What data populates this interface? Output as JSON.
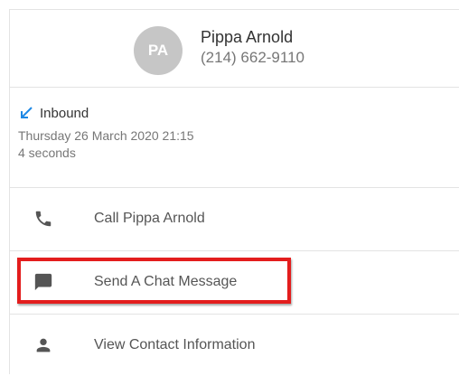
{
  "contact": {
    "initials": "PA",
    "name": "Pippa Arnold",
    "phone": "(214) 662-9110"
  },
  "call": {
    "direction": "Inbound",
    "date": "Thursday 26 March 2020 21:15",
    "duration": "4 seconds"
  },
  "actions": [
    {
      "label": "Call Pippa Arnold",
      "icon": "phone-icon"
    },
    {
      "label": "Send A Chat Message",
      "icon": "chat-icon"
    },
    {
      "label": "View Contact Information",
      "icon": "person-icon"
    }
  ],
  "colors": {
    "avatar_bg": "#c6c6c6",
    "inbound_arrow": "#1e88e5",
    "highlight": "#e31d1d",
    "divider": "#e3e3e3"
  }
}
